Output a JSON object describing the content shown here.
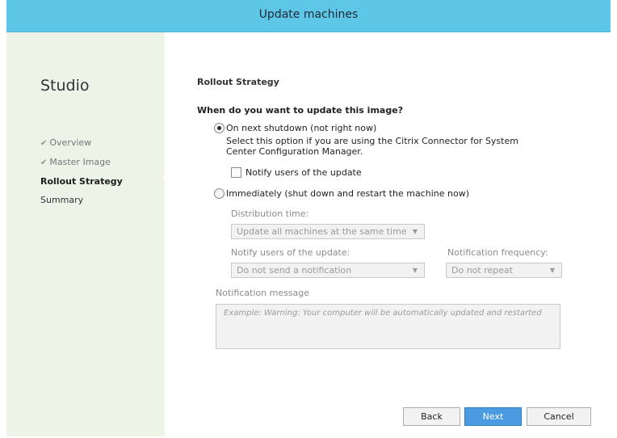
{
  "window": {
    "title": "Update machines"
  },
  "sidebar": {
    "brand": "Studio",
    "steps": [
      {
        "label": "Overview",
        "state": "done"
      },
      {
        "label": "Master Image",
        "state": "done"
      },
      {
        "label": "Rollout Strategy",
        "state": "current"
      },
      {
        "label": "Summary",
        "state": "pending"
      }
    ]
  },
  "main": {
    "heading": "Rollout Strategy",
    "question": "When do you want to update this image?",
    "option_next_shutdown": {
      "label": "On next shutdown (not right now)",
      "selected": true,
      "description": "Select this option if you are using the Citrix Connector for System Center Configuration Manager."
    },
    "notify_checkbox": {
      "label": "Notify users of the update",
      "checked": false
    },
    "option_immediately": {
      "label": "Immediately (shut down and restart the machine now)",
      "selected": false
    },
    "distribution_time": {
      "label": "Distribution time:",
      "value": "Update all machines at the same time"
    },
    "notify_users": {
      "label": "Notify users of the update:",
      "value": "Do not send a notification"
    },
    "notification_frequency": {
      "label": "Notification frequency:",
      "value": "Do not repeat"
    },
    "notification_message": {
      "label": "Notification message",
      "placeholder": "Example:  Warning: Your computer will be automatically updated and restarted"
    }
  },
  "footer": {
    "back_label": "Back",
    "next_label": "Next",
    "cancel_label": "Cancel"
  },
  "colors": {
    "titlebar": "#5ec6e6",
    "sidebar": "#eef3e7",
    "primary_button": "#4a9be0"
  },
  "icons": {
    "step_done": "check-icon",
    "dropdown": "chevron-down-icon"
  }
}
